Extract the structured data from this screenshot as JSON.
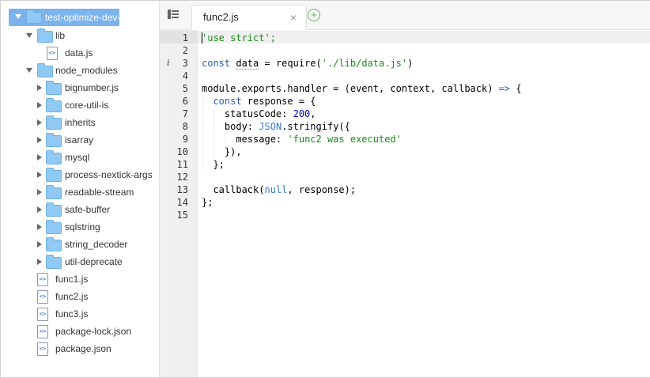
{
  "sidebar": {
    "root": "test-optimize-dev-fu",
    "lib_folder": "lib",
    "lib_file": "data.js",
    "node_modules": "node_modules",
    "modules": [
      "bignumber.js",
      "core-util-is",
      "inherits",
      "isarray",
      "mysql",
      "process-nextick-args",
      "readable-stream",
      "safe-buffer",
      "sqlstring",
      "string_decoder",
      "util-deprecate"
    ],
    "files": [
      "func1.js",
      "func2.js",
      "func3.js",
      "package-lock.json",
      "package.json"
    ]
  },
  "editor": {
    "tab_title": "func2.js",
    "tab_close": "×",
    "add_tab": "+",
    "info_marker": "i",
    "line_numbers": [
      "1",
      "2",
      "3",
      "4",
      "5",
      "6",
      "7",
      "8",
      "9",
      "10",
      "11",
      "12",
      "13",
      "14",
      "15"
    ],
    "code": {
      "l1": "'use strict';",
      "l3_kw": "const",
      "l3_data": "data",
      "l3_rest_a": " = require(",
      "l3_str": "'./lib/data.js'",
      "l3_rest_b": ")",
      "l5_a": "module.exports.handler = (event, context, callback) ",
      "l5_arrow": "=>",
      "l5_b": " {",
      "l6_kw": "const",
      "l6_rest": " response = {",
      "l7_a": "statusCode: ",
      "l7_num": "200",
      "l7_b": ",",
      "l8_a": "body: ",
      "l8_json": "JSON",
      "l8_b": ".stringify({",
      "l9_a": "message: ",
      "l9_str": "'func2 was executed'",
      "l10": "}),",
      "l11": "};",
      "l13_a": "callback(",
      "l13_null": "null",
      "l13_b": ", response);",
      "l14": "};"
    }
  },
  "colors": {
    "selection": "#7bb3ec",
    "folder": "#8fc9f4",
    "string": "#1a8c1a",
    "keyword": "#2b5cbd",
    "add_button": "#67b36b"
  }
}
